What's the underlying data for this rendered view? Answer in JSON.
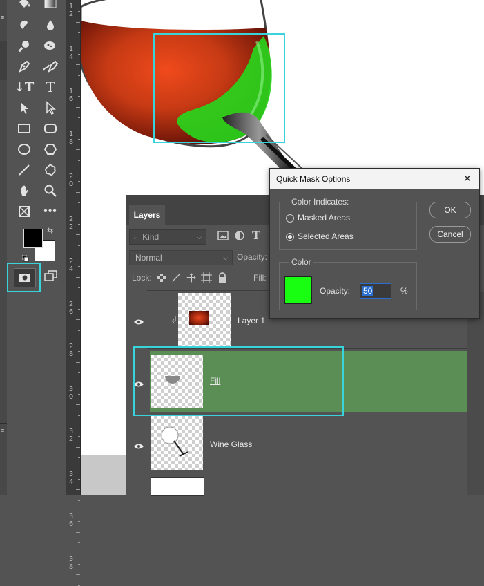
{
  "toolbar": {
    "tools": [
      "paint-bucket",
      "gradient",
      "smudge",
      "blur",
      "dodge",
      "sponge",
      "pen",
      "freeform-pen",
      "vertical-type",
      "horizontal-type",
      "path-selection",
      "direct-selection",
      "rectangle",
      "rounded-rectangle",
      "ellipse",
      "polygon",
      "line",
      "custom-shape",
      "hand",
      "zoom",
      "frame",
      "more-tools"
    ],
    "foreground_color": "#000000",
    "background_color": "#ffffff",
    "quick_mask_active": true
  },
  "ruler": {
    "marks": [
      {
        "top": "1",
        "bottom": "2"
      },
      {
        "top": "1",
        "bottom": "4"
      },
      {
        "top": "1",
        "bottom": "6"
      },
      {
        "top": "1",
        "bottom": "8"
      },
      {
        "top": "2",
        "bottom": "0"
      },
      {
        "top": "2",
        "bottom": "2"
      },
      {
        "top": "2",
        "bottom": "4"
      },
      {
        "top": "2",
        "bottom": "6"
      },
      {
        "top": "2",
        "bottom": "8"
      },
      {
        "top": "3",
        "bottom": "0"
      },
      {
        "top": "3",
        "bottom": "2"
      },
      {
        "top": "3",
        "bottom": "4"
      },
      {
        "top": "3",
        "bottom": "6"
      },
      {
        "top": "3",
        "bottom": "8"
      }
    ]
  },
  "layers_panel": {
    "tab_label": "Layers",
    "filter_kind": "Kind",
    "blend_mode": "Normal",
    "opacity_label": "Opacity:",
    "lock_label": "Lock:",
    "fill_label": "Fill:",
    "layers": [
      {
        "name": "Layer 1",
        "visible": true,
        "selected": false
      },
      {
        "name": "Fill",
        "visible": true,
        "selected": true
      },
      {
        "name": "Wine Glass",
        "visible": true,
        "selected": false
      }
    ],
    "selected_color": "#5a8e55"
  },
  "dialog": {
    "title": "Quick Mask Options",
    "close_glyph": "✕",
    "color_indicates_label": "Color Indicates:",
    "option_masked": "Masked Areas",
    "option_selected": "Selected Areas",
    "selected_option": "Selected Areas",
    "color_label": "Color",
    "swatch_color": "#19ff11",
    "opacity_label": "Opacity:",
    "opacity_value": "50",
    "percent": "%",
    "ok_label": "OK",
    "cancel_label": "Cancel"
  },
  "highlight_color": "#39d3dc"
}
